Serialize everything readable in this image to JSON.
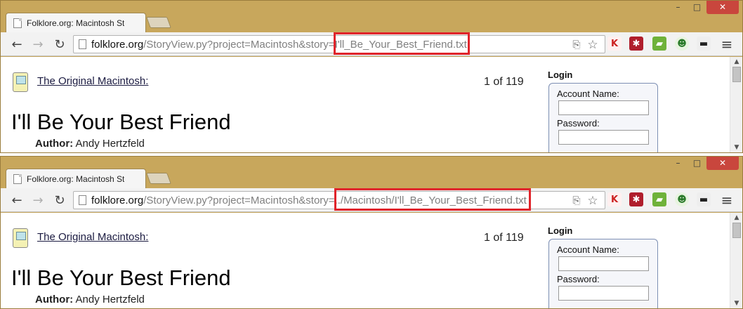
{
  "windows": [
    {
      "tab": {
        "title": "Folklore.org: Macintosh St"
      },
      "omnibox": {
        "url_host": "folklore.org",
        "url_path_before": "/StoryView.py?project=Macintosh&story=",
        "url_highlighted": "I'll_Be_Your_Best_Friend.txt"
      },
      "page": {
        "section_link": "The Original Macintosh:",
        "story_count": "1 of 119",
        "story_title": "I'll Be Your Best Friend",
        "author_label": "Author:",
        "author_name": "Andy Hertzfeld",
        "login": {
          "heading": "Login",
          "account_label": "Account Name:",
          "password_label": "Password:"
        }
      }
    },
    {
      "tab": {
        "title": "Folklore.org: Macintosh St"
      },
      "omnibox": {
        "url_host": "folklore.org",
        "url_path_before": "/StoryView.py?project=Macintosh&story=",
        "url_highlighted": "../Macintosh/I'll_Be_Your_Best_Friend.txt"
      },
      "page": {
        "section_link": "The Original Macintosh:",
        "story_count": "1 of 119",
        "story_title": "I'll Be Your Best Friend",
        "author_label": "Author:",
        "author_name": "Andy Hertzfeld",
        "login": {
          "heading": "Login",
          "account_label": "Account Name:",
          "password_label": "Password:"
        }
      }
    }
  ],
  "window_controls": {
    "minimize": "–",
    "maximize": "□",
    "close": "✕"
  },
  "toolbar_glyphs": {
    "back": "←",
    "forward": "→",
    "reload": "↻",
    "star": "☆",
    "menu": "≡"
  },
  "extension_icons": [
    "kaspersky-icon",
    "lastpass-icon",
    "evernote-icon",
    "monkey-icon",
    "incognito-icon"
  ],
  "colors": {
    "frame": "#c8a75c",
    "highlight": "#e0242b",
    "close_button": "#c9463d"
  }
}
